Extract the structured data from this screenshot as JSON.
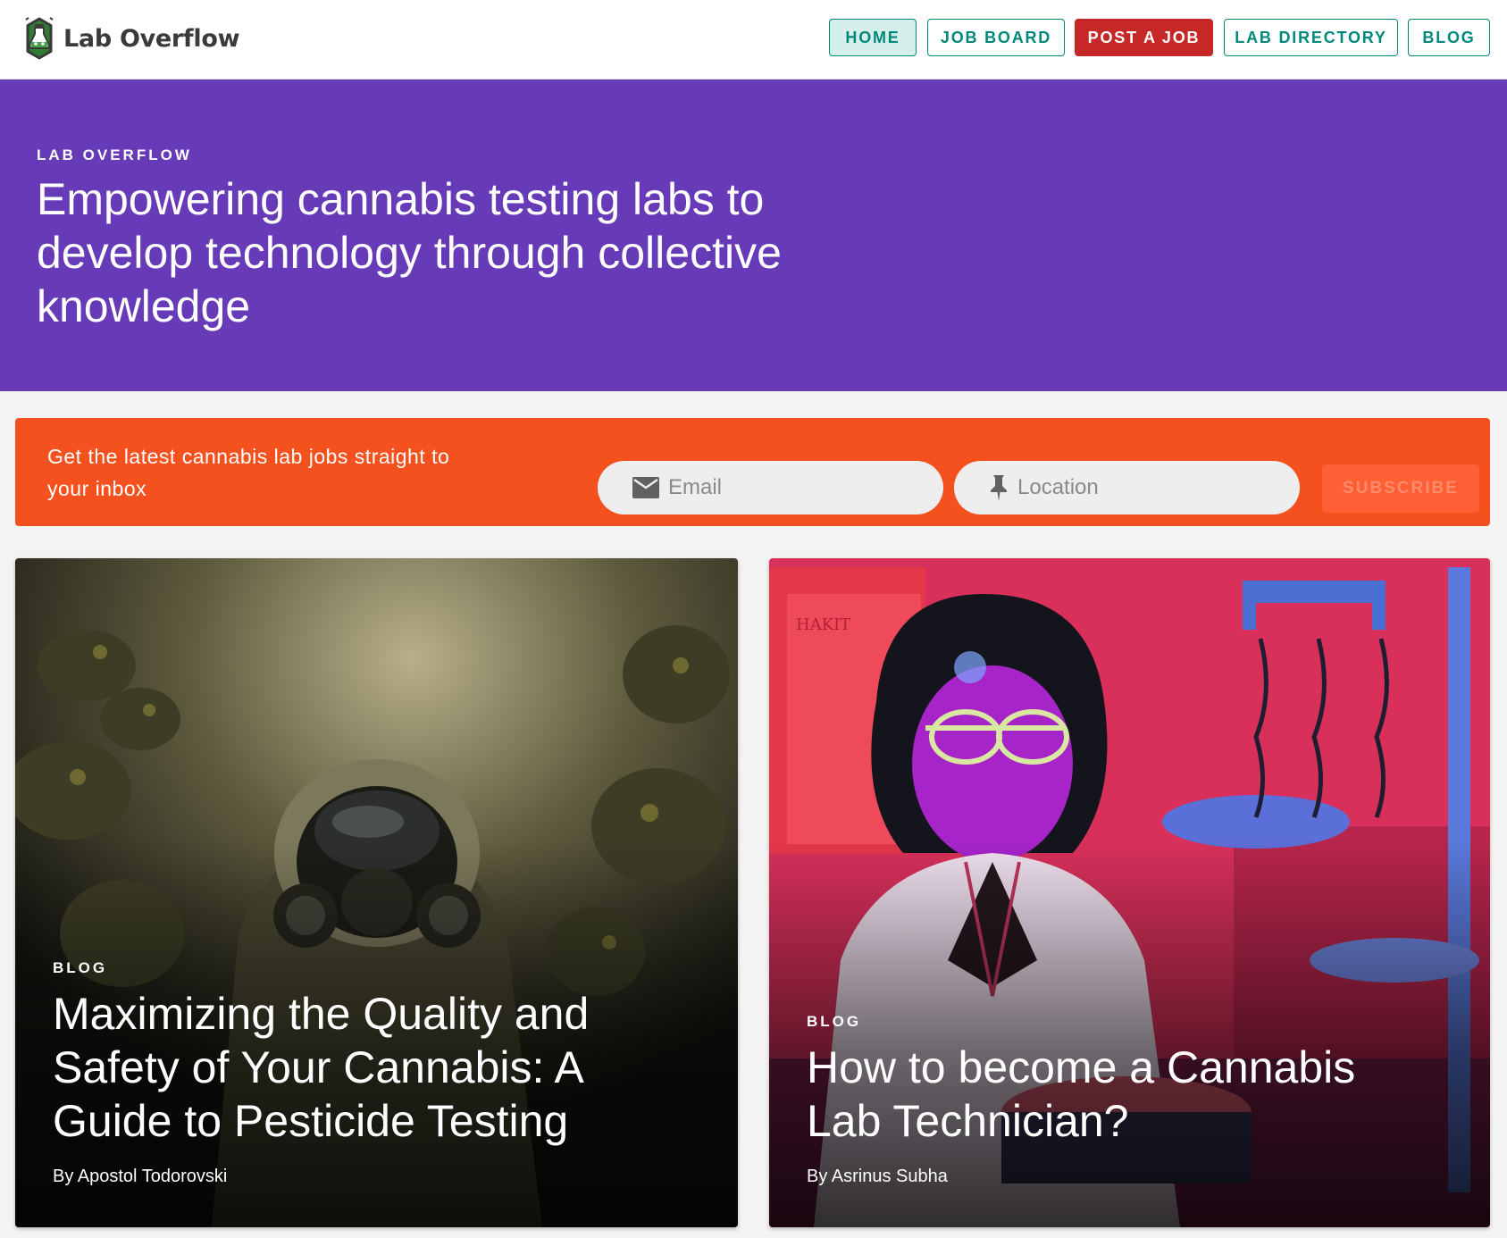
{
  "header": {
    "logo_text": "Lab Overflow",
    "nav": {
      "home": "HOME",
      "job_board": "JOB BOARD",
      "post_job": "POST A JOB",
      "lab_directory": "LAB DIRECTORY",
      "blog": "BLOG"
    },
    "active_nav": "HOME"
  },
  "hero": {
    "eyebrow": "LAB OVERFLOW",
    "title": "Empowering cannabis testing labs to develop technology through collective knowledge"
  },
  "subscribe": {
    "text": "Get the latest cannabis lab jobs straight to your inbox",
    "email_placeholder": "Email",
    "location_placeholder": "Location",
    "button": "SUBSCRIBE",
    "icons": [
      "email-icon",
      "pushpin-icon"
    ]
  },
  "cards": [
    {
      "category": "BLOG",
      "title": "Maximizing the Quality and Safety of Your Cannabis: A Guide to Pesticide Testing",
      "byline": "By Apostol Todorovski"
    },
    {
      "category": "BLOG",
      "title": "How to become a Cannabis Lab Technician?",
      "byline": "By Asrinus Subha"
    }
  ],
  "colors": {
    "teal": "#00897b",
    "post_red": "#c62828",
    "hero_purple": "#673ab7",
    "subscribe_orange": "#f4511e"
  }
}
